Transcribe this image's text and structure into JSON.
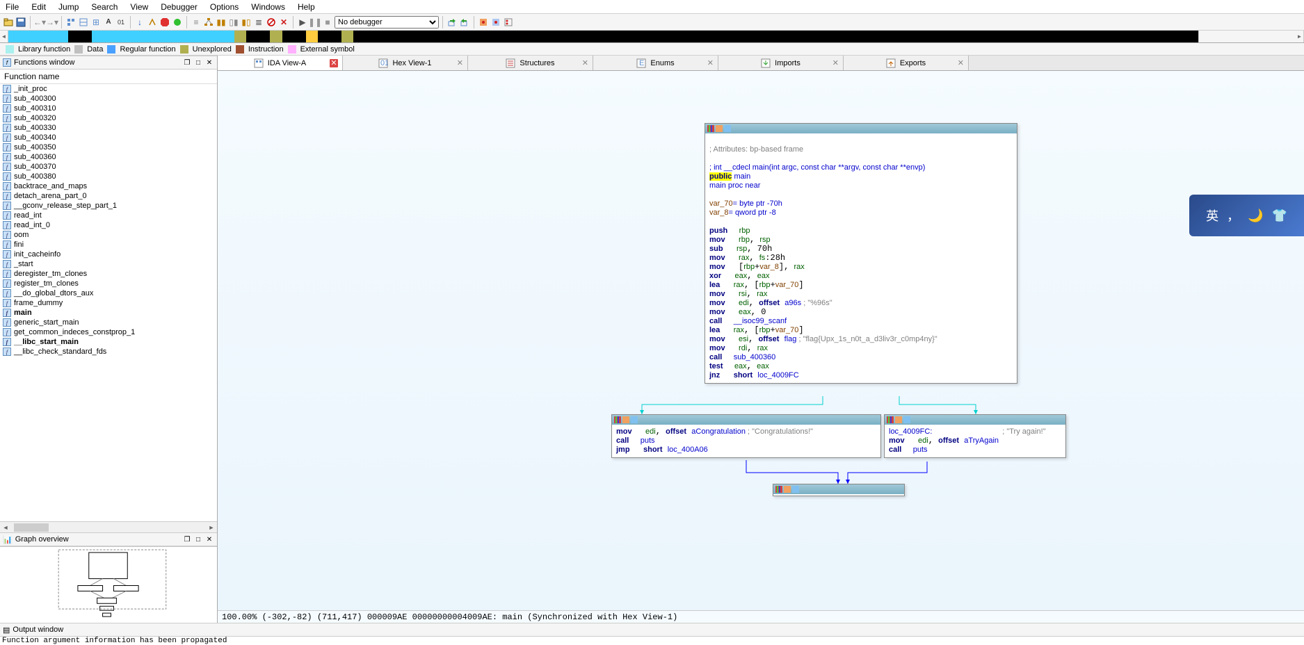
{
  "menu": [
    "File",
    "Edit",
    "Jump",
    "Search",
    "View",
    "Debugger",
    "Options",
    "Windows",
    "Help"
  ],
  "debugger_select": "No debugger",
  "legend": [
    {
      "color": "#aaf0ee",
      "label": "Library function"
    },
    {
      "color": "#c0c0c0",
      "label": "Data"
    },
    {
      "color": "#4aa0ff",
      "label": "Regular function"
    },
    {
      "color": "#b0b050",
      "label": "Unexplored"
    },
    {
      "color": "#a05030",
      "label": "Instruction"
    },
    {
      "color": "#ffb0ff",
      "label": "External symbol"
    }
  ],
  "panels": {
    "functions_title": "Functions window",
    "graph_ov_title": "Graph overview",
    "output_title": "Output window",
    "func_header": "Function name"
  },
  "functions": [
    "_init_proc",
    "sub_400300",
    "sub_400310",
    "sub_400320",
    "sub_400330",
    "sub_400340",
    "sub_400350",
    "sub_400360",
    "sub_400370",
    "sub_400380",
    "backtrace_and_maps",
    "detach_arena_part_0",
    "__gconv_release_step_part_1",
    "read_int",
    "read_int_0",
    "oom",
    "fini",
    "init_cacheinfo",
    "_start",
    "deregister_tm_clones",
    "register_tm_clones",
    "__do_global_dtors_aux",
    "frame_dummy",
    "main",
    "generic_start_main",
    "get_common_indeces_constprop_1",
    "__libc_start_main",
    "__libc_check_standard_fds"
  ],
  "functions_bold": [
    "main",
    "__libc_start_main"
  ],
  "tabs": [
    {
      "icon": "ida-view",
      "label": "IDA View-A",
      "active": true,
      "close_red": true
    },
    {
      "icon": "hex",
      "label": "Hex View-1"
    },
    {
      "icon": "struct",
      "label": "Structures"
    },
    {
      "icon": "enum",
      "label": "Enums"
    },
    {
      "icon": "import",
      "label": "Imports"
    },
    {
      "icon": "export",
      "label": "Exports"
    }
  ],
  "disasm": {
    "main": {
      "cm1": "; Attributes: bp-based frame",
      "cm2": "; int __cdecl main(int argc, const char **argv, const char **envp)",
      "pub": "public",
      "pubn": " main",
      "proc": "main proc near",
      "v1": "var_70",
      "v1d": "= byte ptr -70h",
      "v2": "var_8",
      "v2d": "= qword ptr -8",
      "lines": [
        [
          "push",
          "rbp",
          ""
        ],
        [
          "mov",
          "rbp, rsp",
          ""
        ],
        [
          "sub",
          "rsp, 70h",
          ""
        ],
        [
          "mov",
          "rax, fs:28h",
          ""
        ],
        [
          "mov",
          "[rbp+var_8], rax",
          ""
        ],
        [
          "xor",
          "eax, eax",
          ""
        ],
        [
          "lea",
          "rax, [rbp+var_70]",
          ""
        ],
        [
          "mov",
          "rsi, rax",
          ""
        ],
        [
          "mov",
          "edi, offset a96s",
          " ; \"%96s\""
        ],
        [
          "mov",
          "eax, 0",
          ""
        ],
        [
          "call",
          "__isoc99_scanf",
          ""
        ],
        [
          "lea",
          "rax, [rbp+var_70]",
          ""
        ],
        [
          "mov",
          "esi, offset flag",
          " ; \"flag{Upx_1s_n0t_a_d3liv3r_c0mp4ny}\""
        ],
        [
          "mov",
          "rdi, rax",
          ""
        ],
        [
          "call",
          "sub_400360",
          ""
        ],
        [
          "test",
          "eax, eax",
          ""
        ],
        [
          "jnz",
          "short loc_4009FC",
          ""
        ]
      ]
    },
    "left": {
      "lines": [
        [
          "mov",
          "edi, offset aCongratulation",
          " ; \"Congratulations!\""
        ],
        [
          "call",
          "puts",
          ""
        ],
        [
          "jmp",
          "short loc_400A06",
          ""
        ]
      ]
    },
    "right": {
      "lbl": "loc_4009FC:",
      "lblcm": "; \"Try again!\"",
      "lines": [
        [
          "mov",
          "edi, offset aTryAgain",
          ""
        ],
        [
          "call",
          "puts",
          ""
        ]
      ]
    }
  },
  "status": "100.00% (-302,-82) (711,417) 000009AE 00000000004009AE: main (Synchronized with Hex View-1)",
  "output": "Function argument information has been propagated",
  "widget": {
    "char": "英"
  }
}
